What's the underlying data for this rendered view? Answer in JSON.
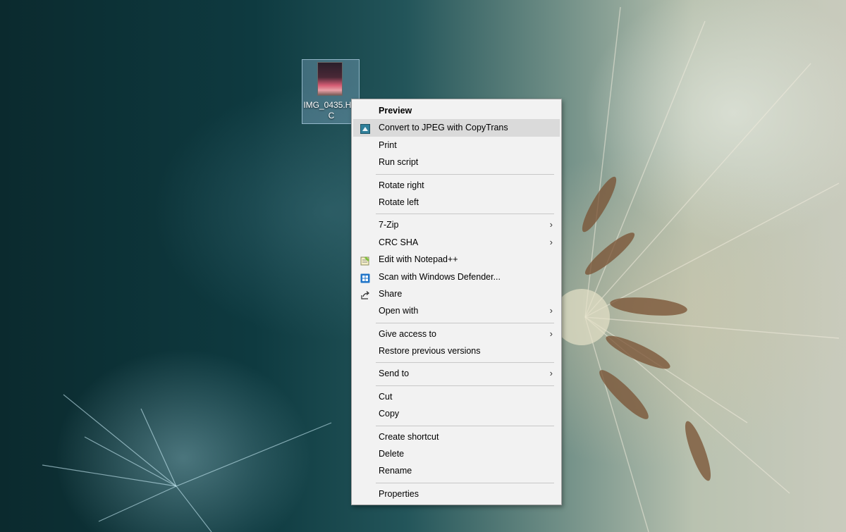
{
  "desktop": {
    "icon_label": "IMG_0435.HEIC"
  },
  "context_menu": {
    "groups": [
      [
        {
          "label": "Preview",
          "bold": true,
          "icon": null,
          "submenu": false
        },
        {
          "label": "Convert to JPEG with CopyTrans",
          "icon": "copytrans-icon",
          "submenu": false,
          "highlighted": true
        },
        {
          "label": "Print",
          "icon": null,
          "submenu": false
        },
        {
          "label": "Run script",
          "icon": null,
          "submenu": false
        }
      ],
      [
        {
          "label": "Rotate right",
          "icon": null,
          "submenu": false
        },
        {
          "label": "Rotate left",
          "icon": null,
          "submenu": false
        }
      ],
      [
        {
          "label": "7-Zip",
          "icon": null,
          "submenu": true
        },
        {
          "label": "CRC SHA",
          "icon": null,
          "submenu": true
        },
        {
          "label": "Edit with Notepad++",
          "icon": "notepadplusplus-icon",
          "submenu": false
        },
        {
          "label": "Scan with Windows Defender...",
          "icon": "windows-defender-icon",
          "submenu": false
        },
        {
          "label": "Share",
          "icon": "share-icon",
          "submenu": false
        },
        {
          "label": "Open with",
          "icon": null,
          "submenu": true
        }
      ],
      [
        {
          "label": "Give access to",
          "icon": null,
          "submenu": true
        },
        {
          "label": "Restore previous versions",
          "icon": null,
          "submenu": false
        }
      ],
      [
        {
          "label": "Send to",
          "icon": null,
          "submenu": true
        }
      ],
      [
        {
          "label": "Cut",
          "icon": null,
          "submenu": false
        },
        {
          "label": "Copy",
          "icon": null,
          "submenu": false
        }
      ],
      [
        {
          "label": "Create shortcut",
          "icon": null,
          "submenu": false
        },
        {
          "label": "Delete",
          "icon": null,
          "submenu": false
        },
        {
          "label": "Rename",
          "icon": null,
          "submenu": false
        }
      ],
      [
        {
          "label": "Properties",
          "icon": null,
          "submenu": false
        }
      ]
    ],
    "submenu_arrow": "›"
  }
}
